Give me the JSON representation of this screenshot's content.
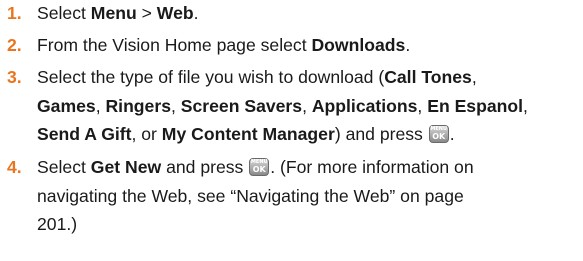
{
  "icons": {
    "ok_key": {
      "name": "menu-ok-key-icon",
      "top_label": "MENU",
      "bottom_label": "OK"
    }
  },
  "colors": {
    "step_number": "#e8761f",
    "text": "#1a1a1a"
  },
  "steps": [
    {
      "number": "1.",
      "lines": [
        [
          "Select ",
          "Menu",
          " > ",
          "Web",
          "."
        ]
      ]
    },
    {
      "number": "2.",
      "lines": [
        [
          "From the Vision Home page select ",
          "Downloads",
          "."
        ]
      ]
    },
    {
      "number": "3.",
      "lines": [
        [
          "Select the type of file you wish to download (",
          "Call Tones",
          ","
        ],
        [
          "Games",
          ", ",
          "Ringers",
          ", ",
          "Screen Savers",
          ", ",
          "Applications",
          ", ",
          "En Espanol",
          ","
        ],
        [
          "Send A Gift",
          ", or ",
          "My Content Manager",
          ") and press ",
          "."
        ]
      ]
    },
    {
      "number": "4.",
      "lines": [
        [
          "Select ",
          "Get New",
          " and press ",
          ". (For more information on"
        ],
        [
          "navigating the Web, see “Navigating the Web” on page"
        ],
        [
          "201.)"
        ]
      ]
    }
  ]
}
